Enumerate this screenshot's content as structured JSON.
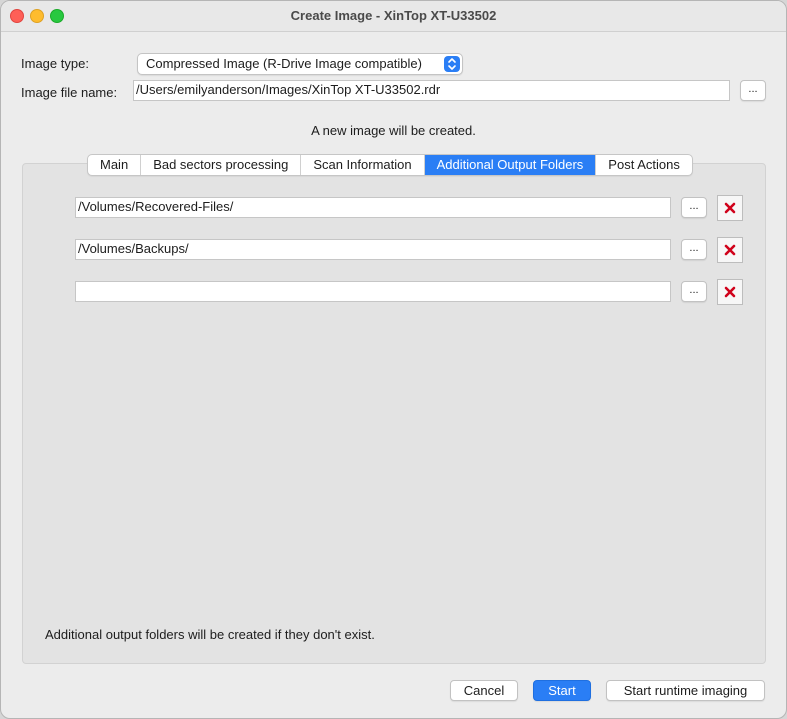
{
  "window": {
    "title": "Create Image - XinTop XT-U33502"
  },
  "form": {
    "image_type_label": "Image type:",
    "image_type_value": "Compressed Image (R-Drive Image compatible)",
    "image_file_label": "Image file name:",
    "image_file_value": "/Users/emilyanderson/Images/XinTop XT-U33502.rdr",
    "browse_label": "..."
  },
  "notice": "A new image will be created.",
  "tabs": [
    {
      "label": "Main"
    },
    {
      "label": "Bad sectors processing"
    },
    {
      "label": "Scan Information"
    },
    {
      "label": "Additional Output Folders",
      "active": true
    },
    {
      "label": "Post Actions"
    }
  ],
  "folders": [
    {
      "value": "/Volumes/Recovered-Files/"
    },
    {
      "value": "/Volumes/Backups/"
    },
    {
      "value": ""
    }
  ],
  "browse_label": "...",
  "footer_note": "Additional output folders will be created if they don't exist.",
  "buttons": {
    "cancel": "Cancel",
    "start": "Start",
    "runtime": "Start runtime imaging"
  },
  "colors": {
    "accent": "#2a7ef5",
    "remove_icon": "#d0021b"
  }
}
